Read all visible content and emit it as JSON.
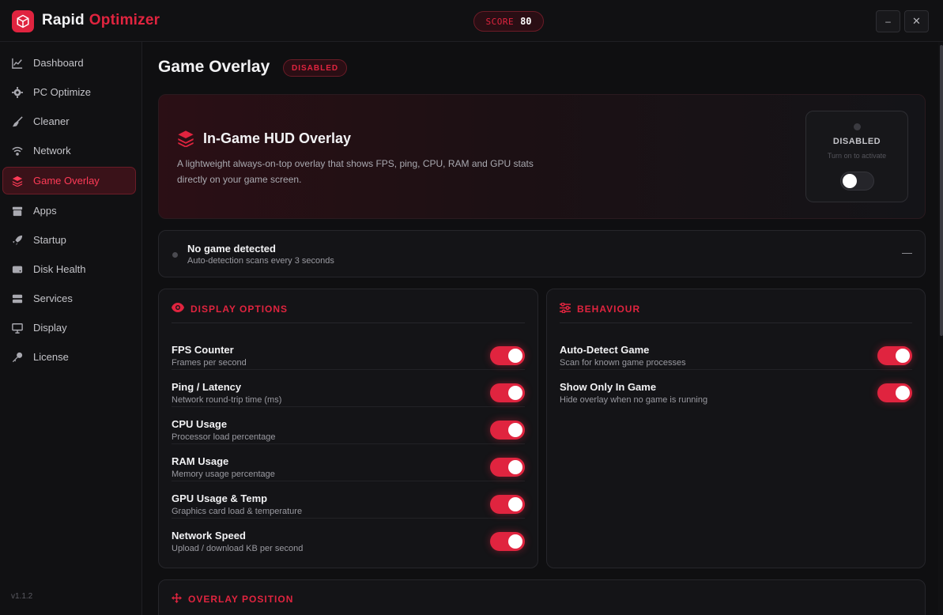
{
  "app": {
    "brand_primary": "Rapid",
    "brand_accent": "Optimizer",
    "score_label": "SCORE",
    "score_value": "80",
    "minimize_glyph": "–",
    "close_glyph": "✕",
    "accent_color": "#e0243f",
    "version": "v1.1.2"
  },
  "sidebar": {
    "items": [
      {
        "label": "Dashboard",
        "icon": "chart-line-icon"
      },
      {
        "label": "PC Optimize",
        "icon": "gear-icon"
      },
      {
        "label": "Cleaner",
        "icon": "broom-icon"
      },
      {
        "label": "Network",
        "icon": "wifi-icon"
      },
      {
        "label": "Game Overlay",
        "icon": "layers-icon",
        "active": true
      },
      {
        "label": "Apps",
        "icon": "archive-box-icon"
      },
      {
        "label": "Startup",
        "icon": "rocket-icon"
      },
      {
        "label": "Disk Health",
        "icon": "hard-drive-icon"
      },
      {
        "label": "Services",
        "icon": "server-icon"
      },
      {
        "label": "Display",
        "icon": "monitor-icon"
      },
      {
        "label": "License",
        "icon": "key-icon"
      }
    ]
  },
  "page": {
    "title": "Game Overlay",
    "status_badge": "DISABLED"
  },
  "hero": {
    "title": "In-Game HUD Overlay",
    "description": "A lightweight always-on-top overlay that shows FPS, ping, CPU, RAM and GPU stats directly on your game screen.",
    "status_label": "DISABLED",
    "status_hint": "Turn on to activate",
    "enabled": false
  },
  "detection": {
    "title": "No game detected",
    "subtitle": "Auto-detection scans every 3 seconds",
    "value": "—"
  },
  "display_options": {
    "heading": "DISPLAY OPTIONS",
    "items": [
      {
        "title": "FPS Counter",
        "subtitle": "Frames per second",
        "enabled": true
      },
      {
        "title": "Ping / Latency",
        "subtitle": "Network round-trip time (ms)",
        "enabled": true
      },
      {
        "title": "CPU Usage",
        "subtitle": "Processor load percentage",
        "enabled": true
      },
      {
        "title": "RAM Usage",
        "subtitle": "Memory usage percentage",
        "enabled": true
      },
      {
        "title": "GPU Usage & Temp",
        "subtitle": "Graphics card load & temperature",
        "enabled": true
      },
      {
        "title": "Network Speed",
        "subtitle": "Upload / download KB per second",
        "enabled": true
      }
    ]
  },
  "behaviour": {
    "heading": "BEHAVIOUR",
    "items": [
      {
        "title": "Auto-Detect Game",
        "subtitle": "Scan for known game processes",
        "enabled": true
      },
      {
        "title": "Show Only In Game",
        "subtitle": "Hide overlay when no game is running",
        "enabled": true
      }
    ]
  },
  "overlay_position": {
    "heading": "OVERLAY POSITION"
  }
}
